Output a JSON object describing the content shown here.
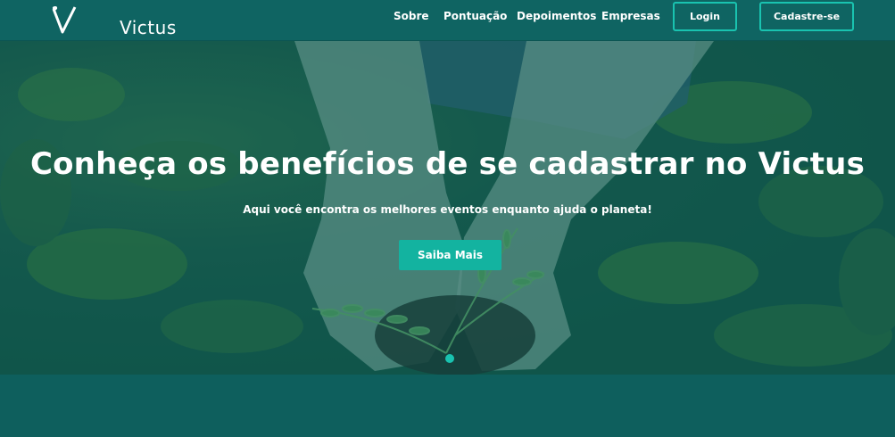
{
  "brand": {
    "name": "Victus"
  },
  "nav": {
    "links": [
      "Sobre",
      "Pontuação",
      "Depoimentos",
      "Empresas"
    ],
    "login_label": "Login",
    "signup_label": "Cadastre-se"
  },
  "hero": {
    "title": "Conheça os benefícios de se cadastrar no Victus",
    "subtitle": "Aqui você encontra os melhores eventos enquanto ajuda o planeta!",
    "cta_label": "Saiba Mais",
    "image_icon": "hands-holding-plant-image"
  },
  "colors": {
    "navbar": "#0f6462",
    "accent": "#19c3b0",
    "button": "#13b3a0",
    "page": "#0e5f5d"
  }
}
